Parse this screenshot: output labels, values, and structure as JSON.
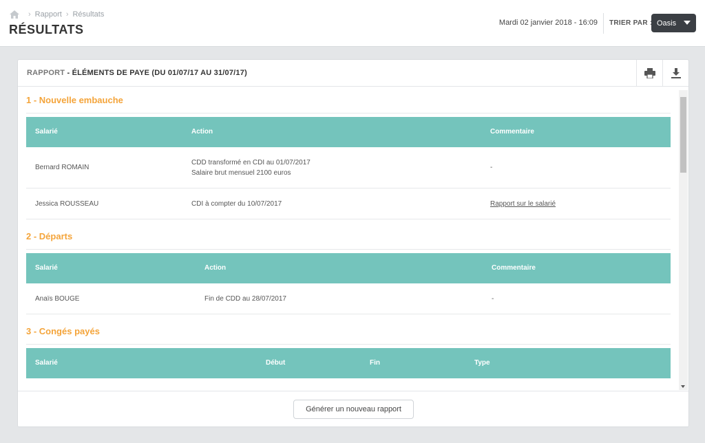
{
  "breadcrumb": {
    "items": [
      "Rapport",
      "Résultats"
    ]
  },
  "header": {
    "title": "RÉSULTATS",
    "datetime": "Mardi 02 janvier 2018 - 16:09",
    "sort_label": "TRIER PAR :",
    "sort_value": "Oasis"
  },
  "report": {
    "title_prefix": "RAPPORT",
    "title_rest": " - ÉLÉMENTS DE PAYE (DU 01/07/17 AU 31/07/17)",
    "sections": [
      {
        "title": "1 - Nouvelle embauche",
        "columns": [
          "Salarié",
          "Action",
          "Commentaire"
        ],
        "rows": [
          {
            "salarie": "Bernard ROMAIN",
            "action_line1": "CDD transformé en CDI au 01/07/2017",
            "action_line2": "Salaire brut mensuel 2100 euros",
            "commentaire": "-"
          },
          {
            "salarie": "Jessica ROUSSEAU",
            "action_line1": "CDI à compter du 10/07/2017",
            "commentaire": "Rapport sur le salarié"
          }
        ]
      },
      {
        "title": "2 - Départs",
        "columns": [
          "Salarié",
          "Action",
          "Commentaire"
        ],
        "rows": [
          {
            "salarie": "Anaïs BOUGE",
            "action_line1": "Fin de CDD au 28/07/2017",
            "commentaire": "-"
          }
        ]
      },
      {
        "title": "3 - Congés payés",
        "columns": [
          "Salarié",
          "Début",
          "Fin",
          "Type"
        ],
        "rows": []
      }
    ]
  },
  "footer": {
    "generate_label": "Générer un nouveau rapport"
  },
  "icons": {
    "home": "home-icon",
    "print": "printer-icon",
    "download": "download-icon"
  },
  "colors": {
    "accent": "#f4a43a",
    "table_header": "#74c4bc",
    "dark": "#3b3f44"
  }
}
